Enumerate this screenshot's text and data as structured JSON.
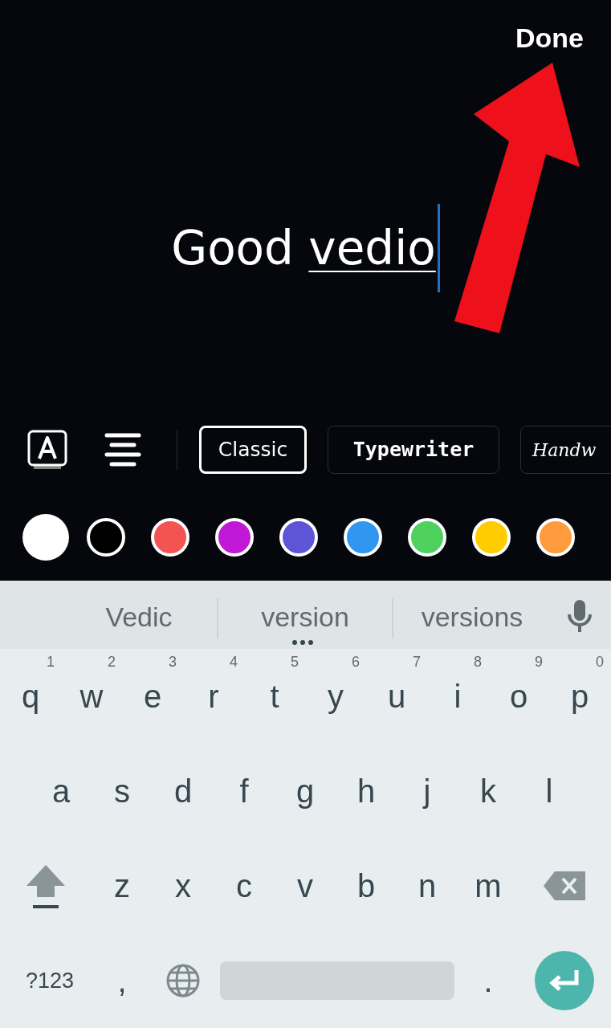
{
  "editor": {
    "done_button": "Done",
    "text": [
      {
        "text": "Good ",
        "composing": false
      },
      {
        "text": "vedio",
        "composing": true
      }
    ]
  },
  "toolbar": {
    "font_styles": [
      {
        "label": "Classic",
        "kind": "classic",
        "selected": true
      },
      {
        "label": "Typewriter",
        "kind": "typewriter",
        "selected": false
      },
      {
        "label": "Handw",
        "kind": "handwriting",
        "selected": false
      }
    ]
  },
  "colors": [
    {
      "color": "#ffffff",
      "selected": true
    },
    {
      "color": "#000000",
      "selected": false
    },
    {
      "color": "#f25353",
      "selected": false
    },
    {
      "color": "#c118d6",
      "selected": false
    },
    {
      "color": "#5d55d6",
      "selected": false
    },
    {
      "color": "#2f97f0",
      "selected": false
    },
    {
      "color": "#4fd160",
      "selected": false
    },
    {
      "color": "#ffcc00",
      "selected": false
    },
    {
      "color": "#ff9a3d",
      "selected": false
    }
  ],
  "keyboard": {
    "suggestions": [
      "Vedic",
      "version",
      "versions"
    ],
    "rows": [
      [
        {
          "label": "q",
          "hint": "1"
        },
        {
          "label": "w",
          "hint": "2"
        },
        {
          "label": "e",
          "hint": "3"
        },
        {
          "label": "r",
          "hint": "4"
        },
        {
          "label": "t",
          "hint": "5"
        },
        {
          "label": "y",
          "hint": "6"
        },
        {
          "label": "u",
          "hint": "7"
        },
        {
          "label": "i",
          "hint": "8"
        },
        {
          "label": "o",
          "hint": "9"
        },
        {
          "label": "p",
          "hint": "0"
        }
      ],
      [
        {
          "label": "a"
        },
        {
          "label": "s"
        },
        {
          "label": "d"
        },
        {
          "label": "f"
        },
        {
          "label": "g"
        },
        {
          "label": "h"
        },
        {
          "label": "j"
        },
        {
          "label": "k"
        },
        {
          "label": "l"
        }
      ],
      [
        {
          "kind": "shift"
        },
        {
          "label": "z"
        },
        {
          "label": "x"
        },
        {
          "label": "c"
        },
        {
          "label": "v"
        },
        {
          "label": "b"
        },
        {
          "label": "n"
        },
        {
          "label": "m"
        },
        {
          "kind": "backspace"
        }
      ]
    ],
    "bottom_row": {
      "symbols_key": "?123",
      "comma_key": ",",
      "period_key": "."
    }
  }
}
